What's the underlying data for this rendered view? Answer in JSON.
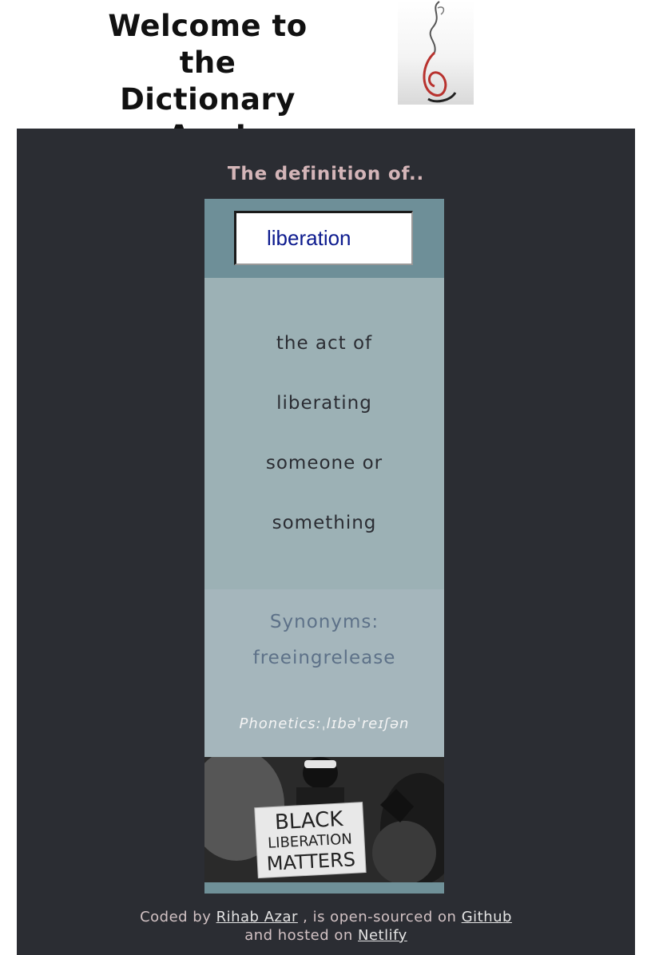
{
  "header": {
    "welcome_line1": "Welcome to the",
    "welcome_line2": "Dictionary App!",
    "logo_icon": "calligraphy-logo-icon"
  },
  "main": {
    "heading": "The definition of..",
    "search": {
      "value": "liberation",
      "placeholder": ""
    },
    "definition_lines": [
      "the act of",
      "liberating",
      "someone or",
      "something"
    ],
    "synonyms_label": "Synonyms:",
    "synonyms_value": "freeingrelease",
    "phonetics": "Phonetics:ˌlɪbəˈreɪʃən",
    "photo": {
      "sign_line1": "BLACK",
      "sign_line2": "LIBERATION",
      "sign_line3": "MATTERS"
    }
  },
  "footer": {
    "coded_by": "Coded by",
    "author_link": "Rihab Azar",
    "open_sourced": ", is open-sourced on",
    "github_link": "Github",
    "hosted_on": "and hosted on",
    "netlify_link": "Netlify"
  },
  "colors": {
    "panel_bg": "#2b2d33",
    "heading": "#d4b5b8",
    "search_area": "#6e8f98",
    "definition_bg": "#9cb1b5",
    "synonyms_bg": "#a5b6bc",
    "synonyms_text": "#5d7188"
  }
}
